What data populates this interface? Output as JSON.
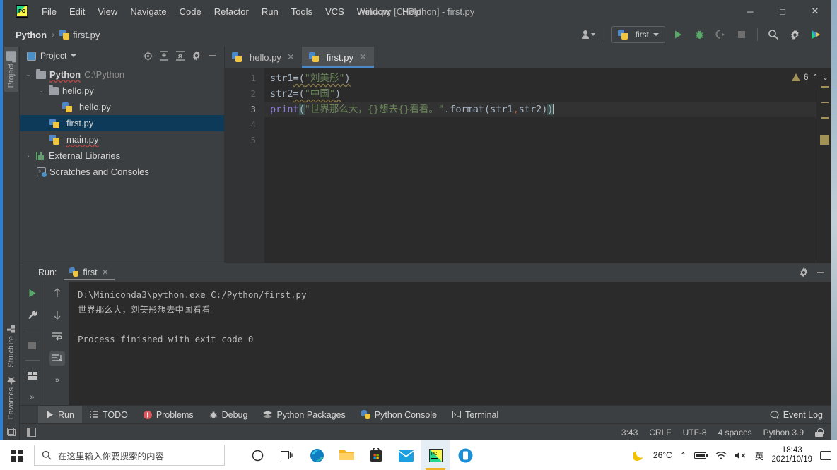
{
  "window": {
    "title": "hello.py [C:\\Python] - first.py",
    "minimize": "─",
    "maximize": "□",
    "close": "✕",
    "logo_text": "PC"
  },
  "menubar": {
    "items": [
      {
        "label": "File"
      },
      {
        "label": "Edit"
      },
      {
        "label": "View"
      },
      {
        "label": "Navigate"
      },
      {
        "label": "Code"
      },
      {
        "label": "Refactor"
      },
      {
        "label": "Run"
      },
      {
        "label": "Tools"
      },
      {
        "label": "VCS"
      },
      {
        "label": "Window"
      },
      {
        "label": "Help"
      }
    ]
  },
  "navbar": {
    "project_name": "Python",
    "separator": "›",
    "file_name": "first.py",
    "run_config": "first",
    "icons": [
      "user-account-icon",
      "run-icon",
      "debug-icon",
      "run-with-coverage-icon",
      "stop-icon",
      "search-everywhere-icon",
      "settings-icon",
      "updates-icon"
    ]
  },
  "left_strip": {
    "project_tab": "Project",
    "structure_tab": "Structure",
    "favorites_tab": "Favorites"
  },
  "project_panel": {
    "title": "Project",
    "tools": [
      "locate-icon",
      "expand-all-icon",
      "collapse-all-icon",
      "settings-icon",
      "hide-icon"
    ],
    "tree": [
      {
        "label": "Python",
        "detail": "C:\\Python",
        "icon": "folder-icon",
        "arrow": "⌄",
        "depth": 0,
        "selected": false,
        "bold": true
      },
      {
        "label": "hello.py",
        "detail": "",
        "icon": "folder-icon",
        "arrow": "⌄",
        "depth": 1,
        "selected": false,
        "bold": false
      },
      {
        "label": "hello.py",
        "detail": "",
        "icon": "python-file-icon",
        "arrow": "",
        "depth": 2,
        "selected": false,
        "bold": false
      },
      {
        "label": "first.py",
        "detail": "",
        "icon": "python-file-icon",
        "arrow": "",
        "depth": 1,
        "selected": true,
        "bold": false
      },
      {
        "label": "main.py",
        "detail": "",
        "icon": "python-file-icon",
        "arrow": "",
        "depth": 1,
        "selected": false,
        "bold": false
      },
      {
        "label": "External Libraries",
        "detail": "",
        "icon": "library-icon",
        "arrow": "›",
        "depth": 0,
        "selected": false,
        "bold": false
      },
      {
        "label": "Scratches and Consoles",
        "detail": "",
        "icon": "scratches-icon",
        "arrow": "",
        "depth": 0,
        "selected": false,
        "bold": false
      }
    ]
  },
  "editor": {
    "tabs": [
      {
        "label": "hello.py",
        "active": false,
        "close": "✕"
      },
      {
        "label": "first.py",
        "active": true,
        "close": "✕"
      }
    ],
    "line_numbers": [
      "1",
      "2",
      "3",
      "4",
      "5"
    ],
    "code": {
      "l1_var": "str1",
      "l1_eq": "=(",
      "l1_str": "\"刘美彤\"",
      "l1_end": ")",
      "l2_var": "str2",
      "l2_eq": "=(",
      "l2_str": "\"中国\"",
      "l2_end": ")",
      "l3_fn": "print",
      "l3_open": "(",
      "l3_str": "\"世界那么大，{}想去{}看看。\"",
      "l3_dot": ".format(str1",
      "l3_comma": ",",
      "l3_args": "str2)",
      "l3_close": ")"
    },
    "warning_count": "6",
    "warning_icon": "warning-triangle-icon",
    "prev_icon": "⌃",
    "next_icon": "⌄"
  },
  "run_panel": {
    "label": "Run:",
    "tab": "first",
    "close": "✕",
    "tools_left": [
      "rerun-icon",
      "wrench-icon",
      "stop-icon",
      "layout-icon",
      "more-icon"
    ],
    "tools_right": [
      "up-arrow-icon",
      "down-arrow-icon",
      "soft-wrap-icon",
      "scroll-to-end-icon",
      "more-icon"
    ],
    "header_icons": [
      "settings-icon",
      "hide-icon"
    ],
    "output": {
      "command": "D:\\Miniconda3\\python.exe C:/Python/first.py",
      "result": "世界那么大，刘美彤想去中国看看。",
      "blank": "",
      "finished": "Process finished with exit code 0"
    }
  },
  "bottom_bar": {
    "tabs": [
      {
        "label": "Run",
        "icon": "run-icon",
        "active": true
      },
      {
        "label": "TODO",
        "icon": "todo-icon",
        "active": false
      },
      {
        "label": "Problems",
        "icon": "problems-icon",
        "active": false
      },
      {
        "label": "Debug",
        "icon": "debug-icon",
        "active": false
      },
      {
        "label": "Python Packages",
        "icon": "packages-icon",
        "active": false
      },
      {
        "label": "Python Console",
        "icon": "python-console-icon",
        "active": false
      },
      {
        "label": "Terminal",
        "icon": "terminal-icon",
        "active": false
      }
    ],
    "event_log": "Event Log",
    "event_log_icon": "balloon-icon"
  },
  "status_bar": {
    "caret_position": "3:43",
    "line_separator": "CRLF",
    "encoding": "UTF-8",
    "indent": "4 spaces",
    "interpreter": "Python 3.9",
    "lock_icon": "lock-icon"
  },
  "taskbar": {
    "start_icon": "windows-start-icon",
    "search_placeholder": "在这里输入你要搜索的内容",
    "search_icon": "search-icon",
    "pinned": [
      {
        "name": "cortana-icon"
      },
      {
        "name": "task-view-icon"
      },
      {
        "name": "edge-icon"
      },
      {
        "name": "file-explorer-icon"
      },
      {
        "name": "microsoft-store-icon"
      },
      {
        "name": "mail-icon"
      },
      {
        "name": "pycharm-icon"
      },
      {
        "name": "phone-link-icon"
      }
    ],
    "tray": {
      "weather_icon": "moon-icon",
      "temperature": "26°C",
      "chevron": "⌃",
      "battery_icon": "battery-icon",
      "wifi_icon": "wifi-icon",
      "volume_icon": "volume-mute-icon",
      "ime": "英",
      "time": "18:43",
      "date": "2021/10/19",
      "notification_icon": "notification-icon"
    }
  },
  "colors": {
    "accent_blue": "#2f7fd0",
    "panel_bg": "#3c3f41",
    "editor_bg": "#2b2b2b",
    "selection": "#0d3a58",
    "string_green": "#6a8759",
    "keyword_orange": "#cc7832",
    "function_violet": "#8f7fd6",
    "warning_yellow": "#a39255",
    "error_red": "#b84a4a"
  }
}
